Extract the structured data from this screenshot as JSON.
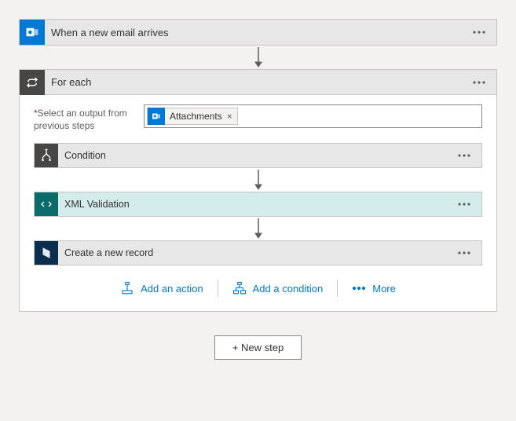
{
  "trigger": {
    "title": "When a new email arrives",
    "icon": "outlook-icon"
  },
  "foreach": {
    "title": "For each",
    "output_label_prefix": "*",
    "output_label": "Select an output from previous steps",
    "token": {
      "label": "Attachments",
      "icon": "outlook-icon"
    },
    "steps": [
      {
        "title": "Condition",
        "icon": "condition-icon",
        "header": "grey",
        "iconBg": "#484644"
      },
      {
        "title": "XML Validation",
        "icon": "xml-icon",
        "header": "teal",
        "iconBg": "#0b6a6a"
      },
      {
        "title": "Create a new record",
        "icon": "dynamics-icon",
        "header": "grey",
        "iconBg": "#0b2e4f"
      }
    ],
    "actions": {
      "add_action": "Add an action",
      "add_condition": "Add a condition",
      "more": "More"
    }
  },
  "new_step": "+ New step"
}
